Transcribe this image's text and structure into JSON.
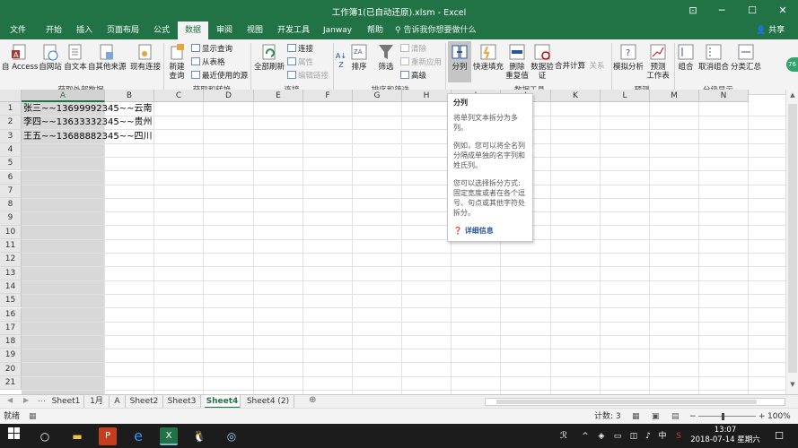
{
  "window": {
    "title": "工作簿1(已自动还原).xlsm - Excel",
    "ribbon_display_icon": "ribbon-display-icon",
    "minimize": "─",
    "maximize": "☐",
    "close": "✕"
  },
  "tabs": [
    "文件",
    "开始",
    "插入",
    "页面布局",
    "公式",
    "数据",
    "审阅",
    "视图",
    "开发工具",
    "Janway",
    "帮助"
  ],
  "active_tab": "数据",
  "tell_me": "告诉我你想要做什么",
  "share": "共享",
  "ribbon": {
    "get_external": {
      "access": "自 Access",
      "web": "自网站",
      "text": "自文本",
      "other": "自其他来源",
      "existing": "现有连接",
      "label": "获取外部数据"
    },
    "get_transform": {
      "new_query_1": "新建",
      "new_query_2": "查询",
      "show_queries": "显示查询",
      "from_table": "从表格",
      "recent": "最近使用的源",
      "label": "获取和转换"
    },
    "connections": {
      "refresh_all": "全部刷新",
      "connections": "连接",
      "properties": "属性",
      "edit_links": "编辑链接",
      "label": "连接"
    },
    "sort_filter": {
      "sort": "排序",
      "filter": "筛选",
      "clear": "清除",
      "reapply": "重新应用",
      "advanced": "高级",
      "label": "排序和筛选"
    },
    "data_tools": {
      "split": "分列",
      "flash_fill": "快速填充",
      "remove_dup_1": "删除",
      "remove_dup_2": "重复值",
      "validation_1": "数据验",
      "validation_2": "证",
      "consolidate": "合并计算",
      "relations": "关系",
      "label": "数据工具"
    },
    "forecast": {
      "whatif": "模拟分析",
      "sheet_1": "预测",
      "sheet_2": "工作表",
      "label": "预测"
    },
    "outline": {
      "group": "组合",
      "ungroup": "取消组合",
      "subtotal": "分类汇总",
      "label": "分级显示"
    }
  },
  "grid": {
    "columns": [
      "A",
      "B",
      "C",
      "D",
      "E",
      "F",
      "G",
      "H",
      "I",
      "J",
      "K",
      "L",
      "M",
      "N"
    ],
    "rows": [
      "1",
      "2",
      "3",
      "4",
      "5",
      "6",
      "7",
      "8",
      "9",
      "10",
      "11",
      "12",
      "13",
      "14",
      "15",
      "16",
      "17",
      "18",
      "19",
      "20",
      "21"
    ],
    "cells": [
      "张三~~13699992345~~云南",
      "李四~~13633332345~~贵州",
      "王五~~13688882345~~四川"
    ]
  },
  "tooltip": {
    "title": "分列",
    "p1": "将单列文本拆分为多列。",
    "p2": "例如，您可以将全名列分隔成单独的名字列和姓氏列。",
    "p3": "您可以选择拆分方式:固定宽度或者在各个逗号、句点或其他字符处拆分。",
    "more": "详细信息"
  },
  "sheets": [
    "Sheet1",
    "1月",
    "A",
    "Sheet2",
    "Sheet3",
    "Sheet4",
    "Sheet4 (2)"
  ],
  "active_sheet": "Sheet4",
  "status": {
    "ready": "就绪",
    "count": "计数: 3",
    "zoom": "100%",
    "minus": "−",
    "plus": "+"
  },
  "taskbar": {
    "time": "13:07",
    "date": "2018-07-14 星期六",
    "lang": "中",
    "badge": "76"
  },
  "colors": {
    "accent": "#217346",
    "tooltip_link": "#2b579a"
  }
}
